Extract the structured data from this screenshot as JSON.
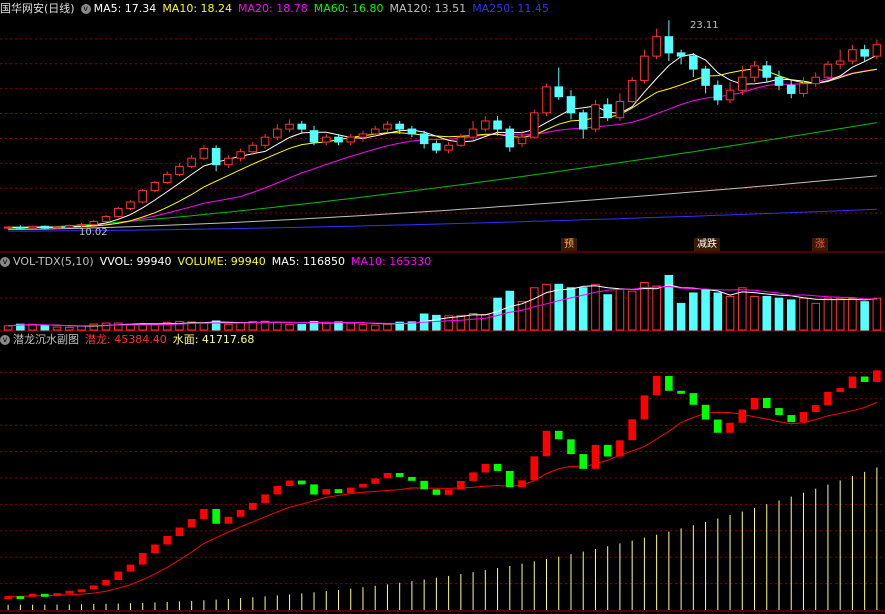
{
  "main_header": {
    "title": "国华网安(日线)",
    "ma5": "MA5: 17.34",
    "ma10": "MA10: 18.24",
    "ma20": "MA20: 18.78",
    "ma60": "MA60: 16.80",
    "ma120": "MA120: 13.51",
    "ma250": "MA250: 11.45"
  },
  "price_labels": {
    "high": "23.11",
    "low": "10.02"
  },
  "tags": {
    "yu": "预",
    "jiandie": "减跌",
    "zhang": "涨"
  },
  "vol_header": {
    "name": "VOL-TDX(5,10)",
    "vvol": "VVOL: 99940",
    "volume": "VOLUME: 99940",
    "ma5": "MA5: 116850",
    "ma10": "MA10: 165330"
  },
  "sub_header": {
    "name": "潜龙沉水副图",
    "qianlong": "潜龙: 45384.40",
    "shuimian": "水面: 41717.68"
  },
  "colors": {
    "up": "#ff3232",
    "down": "#54ffff",
    "ma5": "#ffffff",
    "ma10": "#ffff00",
    "ma20": "#ff00ff",
    "ma60": "#00c000",
    "ma120": "#c0c0c0",
    "ma250": "#3030ff",
    "qianlong_up": "#ff0000",
    "qianlong_down": "#00ff00",
    "shuimian": "#ffff80"
  },
  "chart_data": {
    "type": "candlestick",
    "candles": [
      [
        10.3,
        10.35,
        10.2,
        10.4
      ],
      [
        10.35,
        10.3,
        10.2,
        10.45
      ],
      [
        10.3,
        10.4,
        10.25,
        10.45
      ],
      [
        10.4,
        10.3,
        10.2,
        10.45
      ],
      [
        10.3,
        10.35,
        10.2,
        10.4
      ],
      [
        10.35,
        10.45,
        10.3,
        10.5
      ],
      [
        10.45,
        10.5,
        10.35,
        10.6
      ],
      [
        10.5,
        10.7,
        10.45,
        10.8
      ],
      [
        10.7,
        11.0,
        10.65,
        11.1
      ],
      [
        11.0,
        11.5,
        10.95,
        11.6
      ],
      [
        11.5,
        11.9,
        11.4,
        12.0
      ],
      [
        11.9,
        12.6,
        11.8,
        12.7
      ],
      [
        12.6,
        13.1,
        12.5,
        13.2
      ],
      [
        13.1,
        13.6,
        13.0,
        13.8
      ],
      [
        13.6,
        14.1,
        13.5,
        14.3
      ],
      [
        14.1,
        14.6,
        14.0,
        14.8
      ],
      [
        14.6,
        15.2,
        14.5,
        15.4
      ],
      [
        15.2,
        14.2,
        13.8,
        15.4
      ],
      [
        14.2,
        14.6,
        14.0,
        14.8
      ],
      [
        14.6,
        15.0,
        14.4,
        15.2
      ],
      [
        15.0,
        15.4,
        14.8,
        15.6
      ],
      [
        15.4,
        15.9,
        15.2,
        16.1
      ],
      [
        15.9,
        16.4,
        15.7,
        16.7
      ],
      [
        16.4,
        16.7,
        16.2,
        17.0
      ],
      [
        16.7,
        16.4,
        16.1,
        16.9
      ],
      [
        16.3,
        15.6,
        15.4,
        16.6
      ],
      [
        15.6,
        15.9,
        15.4,
        16.1
      ],
      [
        15.9,
        15.6,
        15.4,
        16.1
      ],
      [
        15.6,
        15.9,
        15.4,
        16.1
      ],
      [
        15.9,
        16.1,
        15.6,
        16.3
      ],
      [
        16.1,
        16.4,
        15.9,
        16.6
      ],
      [
        16.4,
        16.7,
        16.2,
        16.9
      ],
      [
        16.7,
        16.4,
        16.1,
        16.9
      ],
      [
        16.4,
        16.1,
        15.9,
        16.6
      ],
      [
        16.1,
        15.5,
        15.2,
        16.3
      ],
      [
        15.5,
        15.1,
        14.9,
        15.7
      ],
      [
        15.1,
        15.4,
        14.9,
        15.6
      ],
      [
        15.4,
        15.9,
        15.3,
        16.1
      ],
      [
        15.9,
        16.4,
        15.7,
        16.9
      ],
      [
        16.4,
        16.9,
        16.2,
        17.2
      ],
      [
        16.9,
        16.4,
        16.0,
        17.2
      ],
      [
        16.4,
        15.3,
        15.0,
        16.6
      ],
      [
        15.5,
        15.9,
        15.3,
        16.3
      ],
      [
        15.9,
        17.4,
        15.8,
        17.6
      ],
      [
        17.4,
        19.0,
        17.2,
        19.2
      ],
      [
        19.0,
        18.4,
        18.2,
        20.2
      ],
      [
        18.4,
        17.4,
        17.0,
        18.8
      ],
      [
        17.4,
        16.4,
        15.8,
        17.6
      ],
      [
        16.4,
        17.9,
        16.2,
        18.2
      ],
      [
        17.9,
        17.1,
        16.9,
        18.3
      ],
      [
        17.1,
        18.1,
        16.9,
        18.6
      ],
      [
        18.1,
        19.4,
        18.0,
        19.6
      ],
      [
        19.4,
        20.9,
        19.2,
        21.3
      ],
      [
        20.9,
        22.1,
        20.7,
        22.6
      ],
      [
        22.1,
        21.1,
        20.6,
        23.11
      ],
      [
        21.1,
        20.9,
        20.4,
        21.3
      ],
      [
        20.9,
        20.1,
        19.6,
        21.1
      ],
      [
        20.1,
        19.1,
        18.6,
        20.3
      ],
      [
        19.1,
        18.2,
        17.9,
        19.4
      ],
      [
        18.2,
        18.8,
        18.0,
        19.3
      ],
      [
        18.8,
        19.6,
        18.5,
        20.3
      ],
      [
        19.6,
        20.3,
        19.3,
        20.6
      ],
      [
        20.3,
        19.6,
        19.3,
        20.6
      ],
      [
        19.6,
        19.1,
        18.8,
        20.0
      ],
      [
        19.1,
        18.6,
        18.3,
        19.4
      ],
      [
        18.6,
        19.2,
        18.4,
        19.6
      ],
      [
        19.2,
        19.6,
        19.0,
        19.9
      ],
      [
        19.6,
        20.4,
        19.4,
        20.6
      ],
      [
        20.4,
        20.6,
        20.1,
        21.3
      ],
      [
        20.6,
        21.3,
        20.4,
        21.6
      ],
      [
        21.3,
        20.9,
        20.6,
        21.6
      ],
      [
        20.9,
        21.6,
        20.7,
        21.9
      ]
    ],
    "price_range": [
      9.8,
      23.5
    ],
    "volume_range": [
      0,
      350000
    ],
    "qianlong_range": [
      0,
      50000
    ]
  }
}
